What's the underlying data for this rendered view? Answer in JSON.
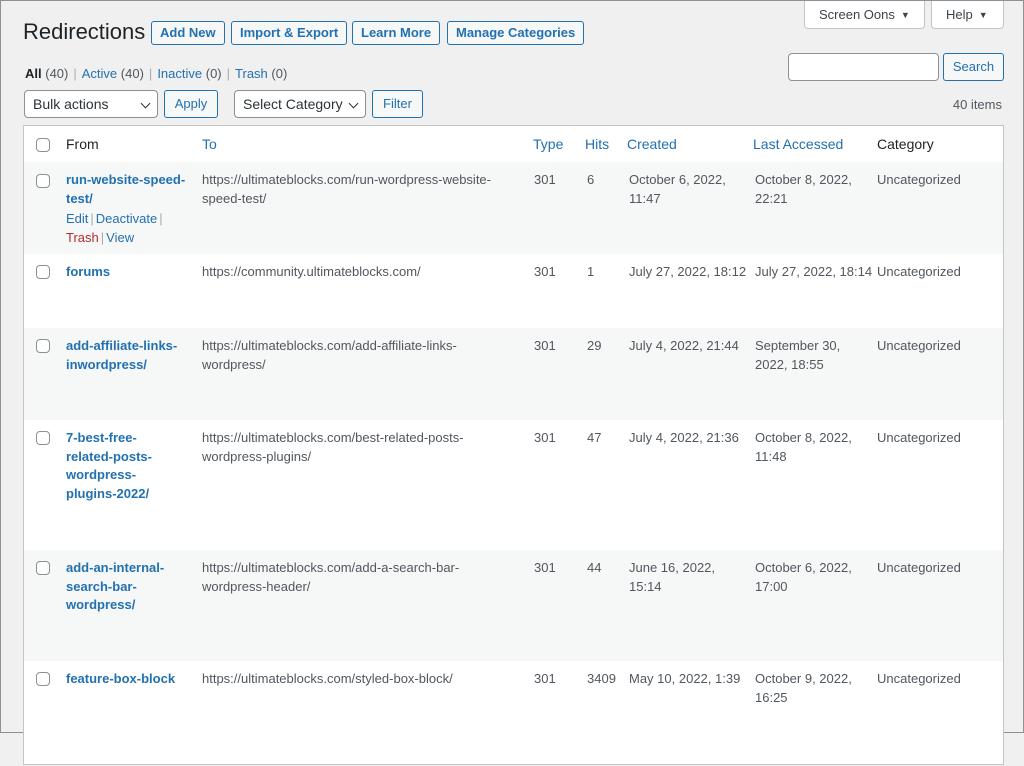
{
  "page": {
    "title": "Redirections"
  },
  "header_buttons": {
    "add_new": "Add New",
    "import_export": "Import & Export",
    "learn_more": "Learn More",
    "manage_categories": "Manage Categories"
  },
  "screen_tabs": {
    "screen_options": "Screen Oons",
    "help": "Help"
  },
  "views": [
    {
      "label": "All",
      "count": "(40)"
    },
    {
      "label": "Active",
      "count": "(40)"
    },
    {
      "label": "Inactive",
      "count": "(0)"
    },
    {
      "label": "Trash",
      "count": "(0)"
    }
  ],
  "search": {
    "value": "",
    "button": "Search"
  },
  "toolbar": {
    "bulk_actions": "Bulk actions",
    "apply": "Apply",
    "category_select": "Select Category",
    "filter": "Filter",
    "items_count": "40 items"
  },
  "columns": {
    "from": "From",
    "to": "To",
    "type": "Type",
    "hits": "Hits",
    "created": "Created",
    "last_accessed": "Last Accessed",
    "category": "Category"
  },
  "row_actions": {
    "edit": "Edit",
    "deactivate": "Deactivate",
    "trash": "Trash",
    "view": "View"
  },
  "rows": [
    {
      "from": "run-website-speed-test/",
      "to": "https://ultimateblocks.com/run-wordpress-website-speed-test/",
      "type": "301",
      "hits": "6",
      "created": "October 6, 2022, 11:47",
      "last": "October 8, 2022, 22:21",
      "category": "Uncategorized"
    },
    {
      "from": "forums",
      "to": "https://community.ultimateblocks.com/",
      "type": "301",
      "hits": "1",
      "created": "July 27, 2022, 18:12",
      "last": "July 27, 2022, 18:14",
      "category": "Uncategorized"
    },
    {
      "from": "add-affiliate-links-inwordpress/",
      "to": "https://ultimateblocks.com/add-affiliate-links-wordpress/",
      "type": "301",
      "hits": "29",
      "created": "July 4, 2022, 21:44",
      "last": "September 30, 2022, 18:55",
      "category": "Uncategorized"
    },
    {
      "from": "7-best-free-related-posts-wordpress-plugins-2022/",
      "to": "https://ultimateblocks.com/best-related-posts-wordpress-plugins/",
      "type": "301",
      "hits": "47",
      "created": "July 4, 2022, 21:36",
      "last": "October 8, 2022, 11:48",
      "category": "Uncategorized"
    },
    {
      "from": "add-an-internal-search-bar-wordpress/",
      "to": "https://ultimateblocks.com/add-a-search-bar-wordpress-header/",
      "type": "301",
      "hits": "44",
      "created": "June 16, 2022, 15:14",
      "last": "October 6, 2022, 17:00",
      "category": "Uncategorized"
    },
    {
      "from": "feature-box-block",
      "to": "https://ultimateblocks.com/styled-box-block/",
      "type": "301",
      "hits": "3409",
      "created": "May 10, 2022, 1:39",
      "last": "October 9, 2022, 16:25",
      "category": "Uncategorized"
    }
  ]
}
